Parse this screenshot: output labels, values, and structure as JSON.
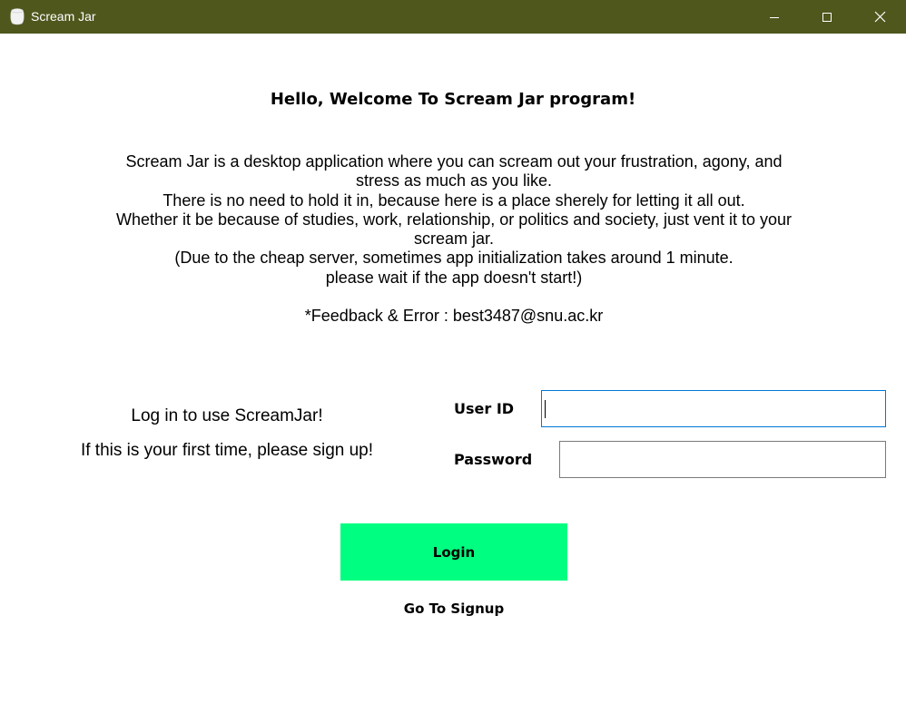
{
  "window": {
    "title": "Scream Jar",
    "titlebar_color": "#4f571d",
    "icon": "jar-icon",
    "controls": [
      "minimize-icon",
      "maximize-icon",
      "close-icon"
    ]
  },
  "main": {
    "heading": "Hello, Welcome To Scream Jar program!",
    "description_lines": [
      "Scream Jar is a desktop application where you can scream out your frustration, agony, and",
      "stress as much as you like.",
      "There is no need to hold it in, because here is a place sherely for letting it all out.",
      "Whether it be because of studies, work, relationship, or politics and society, just vent it to your",
      "scream jar.",
      "(Due to the cheap server, sometimes app initialization takes around 1 minute.",
      "please wait if the app doesn't start!)"
    ],
    "feedback": "*Feedback & Error : best3487@snu.ac.kr"
  },
  "login": {
    "prompt": "Log in to use ScreamJar!",
    "signup_prompt": "If this is your first time, please sign up!",
    "userid_label": "User ID",
    "userid_value": "",
    "password_label": "Password",
    "password_value": "",
    "login_button": "Login",
    "login_button_color": "#00ff80",
    "signup_link": "Go To Signup"
  }
}
